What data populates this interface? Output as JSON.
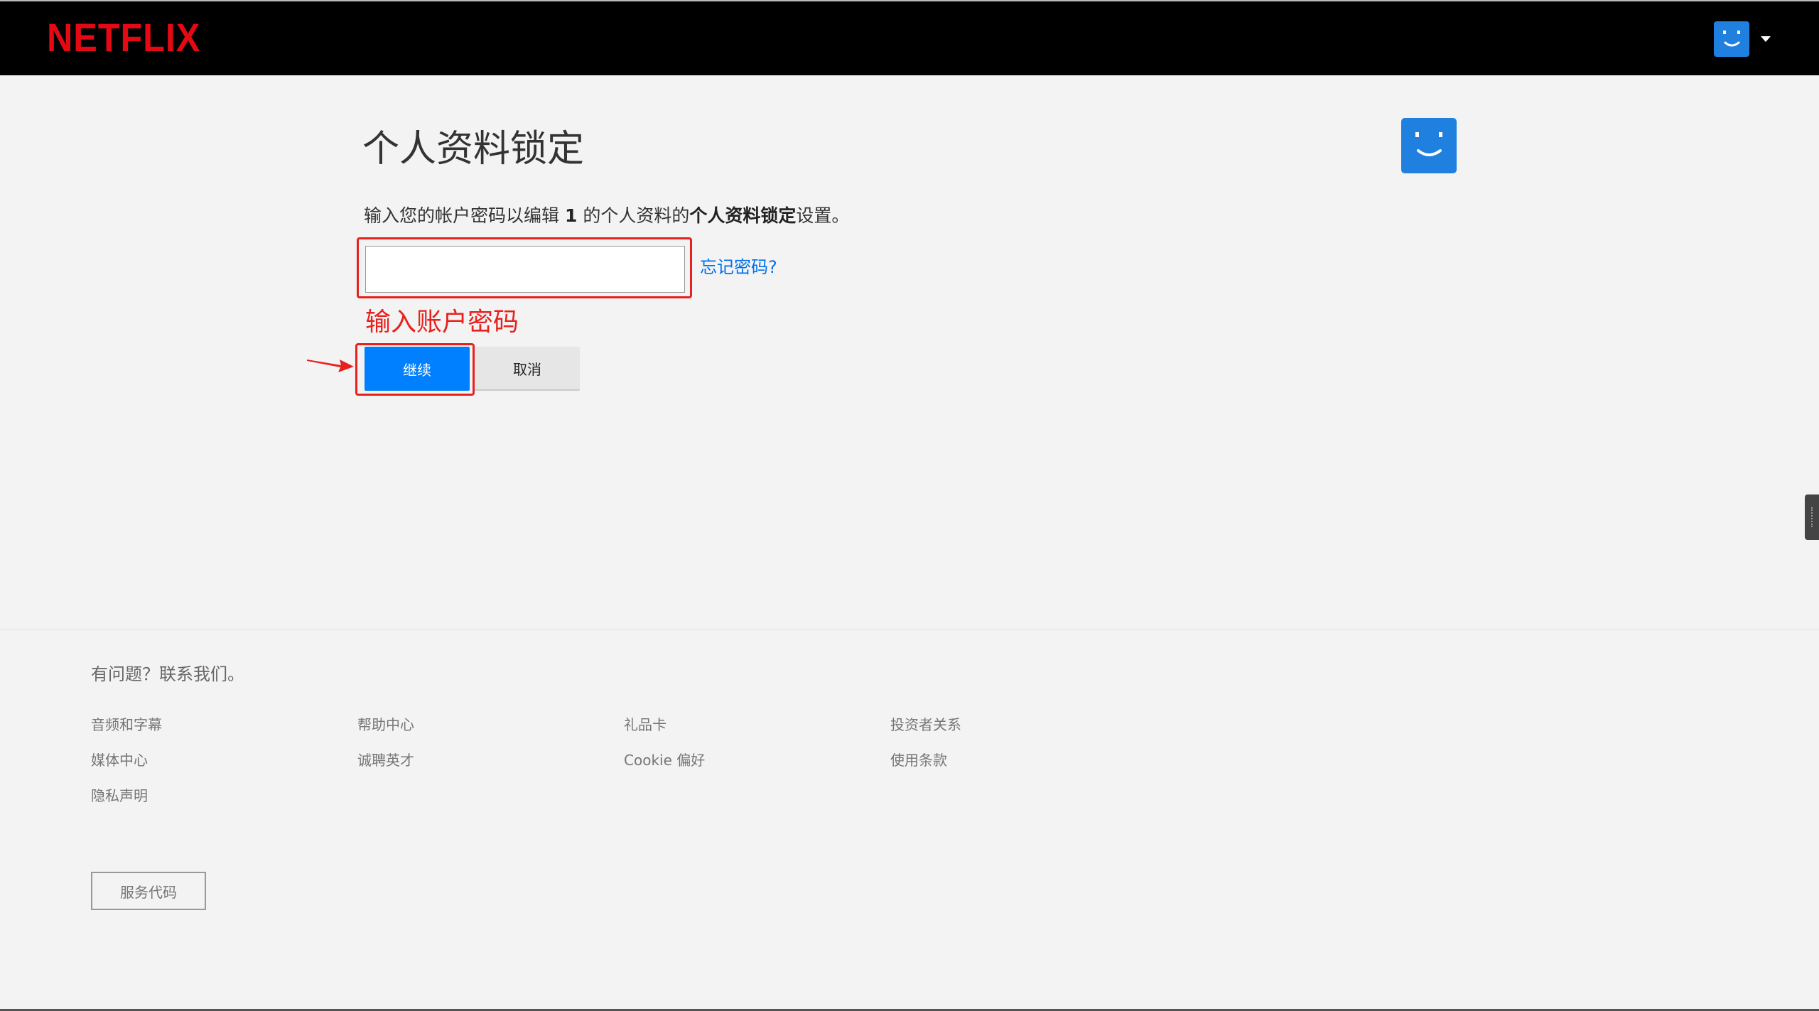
{
  "header": {
    "logo_text": "NETFLIX",
    "avatar_icon": "smiley-avatar-icon",
    "menu_icon": "caret-down-icon"
  },
  "main": {
    "title": "个人资料锁定",
    "description_prefix": "输入您的帐户密码以编辑",
    "description_count": "1",
    "description_mid": "的个人资料的",
    "description_bold": "个人资料锁定",
    "description_suffix": "设置。",
    "password_input": {
      "value": "",
      "placeholder": ""
    },
    "forgot_link": "忘记密码?",
    "annotation_text": "输入账户密码",
    "continue_label": "继续",
    "cancel_label": "取消"
  },
  "footer": {
    "contact": "有问题？联系我们。",
    "links": [
      "音频和字幕",
      "帮助中心",
      "礼品卡",
      "投资者关系",
      "媒体中心",
      "诚聘英才",
      "Cookie 偏好",
      "使用条款",
      "隐私声明"
    ],
    "service_code_label": "服务代码"
  },
  "colors": {
    "brand_red": "#e50914",
    "accent_blue": "#0080ff",
    "link_blue": "#0071eb",
    "annotation_red": "#e8211e",
    "avatar_blue": "#1f80e0"
  }
}
